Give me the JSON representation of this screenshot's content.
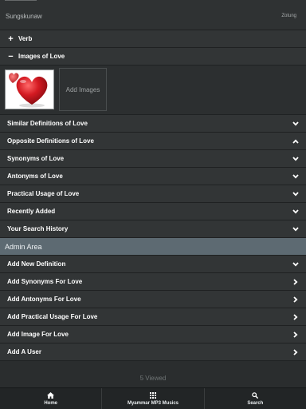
{
  "header": {
    "left_text": "Sungskunaw",
    "right_text": "Zotung"
  },
  "verb_row": {
    "label": "Verb",
    "toggle_icon": "plus-icon"
  },
  "images_row": {
    "label": "Images of Love",
    "toggle_icon": "minus-icon"
  },
  "images": {
    "thumbnail_icon": "heart-image",
    "add_label": "Add Images"
  },
  "definition_rows": [
    {
      "label": "Similar Definitions of Love",
      "chevron": "chevron-down-icon"
    },
    {
      "label": "Opposite Definitions of Love",
      "chevron": "chevron-up-icon"
    },
    {
      "label": "Synonyms of Love",
      "chevron": "chevron-down-icon"
    },
    {
      "label": "Antonyms of Love",
      "chevron": "chevron-down-icon"
    },
    {
      "label": "Practical Usage of Love",
      "chevron": "chevron-down-icon"
    },
    {
      "label": "Recently Added",
      "chevron": "chevron-down-icon"
    },
    {
      "label": "Your Search History",
      "chevron": "chevron-down-icon"
    }
  ],
  "admin": {
    "title": "Admin Area",
    "rows": [
      {
        "label": "Add New Definition",
        "chevron": "chevron-down-icon"
      },
      {
        "label": "Add Synonyms For Love",
        "chevron": "chevron-right-icon"
      },
      {
        "label": "Add Antonyms For Love",
        "chevron": "chevron-right-icon"
      },
      {
        "label": "Add Practical Usage For Love",
        "chevron": "chevron-right-icon"
      },
      {
        "label": "Add Image For Love",
        "chevron": "chevron-right-icon"
      },
      {
        "label": "Add A User",
        "chevron": "chevron-right-icon"
      }
    ]
  },
  "footer": {
    "viewed_text": "5 Viewed"
  },
  "navbar": {
    "items": [
      {
        "label": "Home",
        "icon": "home-icon"
      },
      {
        "label": "Myammar MP3 Musics",
        "icon": "grid-icon"
      },
      {
        "label": "Search",
        "icon": "search-icon"
      }
    ]
  },
  "colors": {
    "background": "#2a2d2e",
    "row": "#323536",
    "admin_header": "#5d6a72",
    "navbar": "#222526",
    "heart": "#c8161d"
  }
}
